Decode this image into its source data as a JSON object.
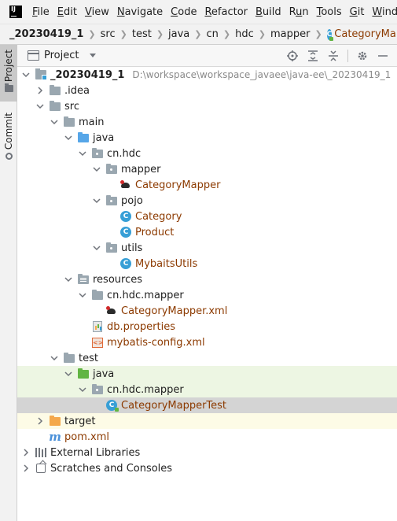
{
  "menubar": {
    "logo_text": "IJ",
    "items": [
      {
        "label": "File",
        "mnemonic": "F"
      },
      {
        "label": "Edit",
        "mnemonic": "E"
      },
      {
        "label": "View",
        "mnemonic": "V"
      },
      {
        "label": "Navigate",
        "mnemonic": "N"
      },
      {
        "label": "Code",
        "mnemonic": "C"
      },
      {
        "label": "Refactor",
        "mnemonic": "R"
      },
      {
        "label": "Build",
        "mnemonic": "B"
      },
      {
        "label": "Run",
        "mnemonic": "u"
      },
      {
        "label": "Tools",
        "mnemonic": "T"
      },
      {
        "label": "Git",
        "mnemonic": "G"
      },
      {
        "label": "Windo",
        "mnemonic": "W"
      }
    ]
  },
  "breadcrumb": [
    "_20230419_1",
    "src",
    "test",
    "java",
    "cn",
    "hdc",
    "mapper",
    "CategoryMapperTest"
  ],
  "breadcrumb_last_icon": "class-test-icon",
  "side_tabs": {
    "project": "Project",
    "commit": "Commit"
  },
  "panel": {
    "title": "Project",
    "tools": [
      "locate-icon",
      "expand-all-icon",
      "collapse-all-icon",
      "gear-icon",
      "minimize-icon"
    ]
  },
  "tree": [
    {
      "label": "_20230419_1",
      "path": "D:\\workspace\\workspace_javaee\\java-ee\\_20230419_1",
      "icon": "module-icon",
      "expanded": true,
      "style": "bold"
    },
    {
      "label": ".idea",
      "icon": "folder-icon",
      "expanded": false
    },
    {
      "label": "src",
      "icon": "folder-icon",
      "expanded": true
    },
    {
      "label": "main",
      "icon": "folder-icon",
      "expanded": true
    },
    {
      "label": "java",
      "icon": "source-folder-icon",
      "expanded": true
    },
    {
      "label": "cn.hdc",
      "icon": "package-icon",
      "expanded": true
    },
    {
      "label": "mapper",
      "icon": "package-icon",
      "expanded": true
    },
    {
      "label": "CategoryMapper",
      "icon": "mybatis-mapper-icon",
      "style": "brown"
    },
    {
      "label": "pojo",
      "icon": "package-icon",
      "expanded": true
    },
    {
      "label": "Category",
      "icon": "class-icon",
      "style": "brown"
    },
    {
      "label": "Product",
      "icon": "class-icon",
      "style": "brown"
    },
    {
      "label": "utils",
      "icon": "package-icon",
      "expanded": true
    },
    {
      "label": "MybaitsUtils",
      "icon": "class-icon",
      "style": "brown"
    },
    {
      "label": "resources",
      "icon": "resources-folder-icon",
      "expanded": true
    },
    {
      "label": "cn.hdc.mapper",
      "icon": "folder-icon",
      "expanded": true
    },
    {
      "label": "CategoryMapper.xml",
      "icon": "mybatis-xml-icon",
      "style": "brown"
    },
    {
      "label": "db.properties",
      "icon": "properties-file-icon",
      "style": "brown"
    },
    {
      "label": "mybatis-config.xml",
      "icon": "xml-file-icon",
      "style": "brown"
    },
    {
      "label": "test",
      "icon": "folder-icon",
      "expanded": true
    },
    {
      "label": "java",
      "icon": "test-source-folder-icon",
      "expanded": true,
      "highlight": "green"
    },
    {
      "label": "cn.hdc.mapper",
      "icon": "package-icon",
      "expanded": true,
      "highlight": "green"
    },
    {
      "label": "CategoryMapperTest",
      "icon": "test-class-icon",
      "style": "brown",
      "highlight": "selected"
    },
    {
      "label": "target",
      "icon": "excluded-folder-icon",
      "expanded": false,
      "highlight": "yellow"
    },
    {
      "label": "pom.xml",
      "icon": "maven-icon",
      "style": "brown"
    },
    {
      "label": "External Libraries",
      "icon": "libraries-icon",
      "expanded": false
    },
    {
      "label": "Scratches and Consoles",
      "icon": "scratches-icon",
      "expanded": false
    }
  ]
}
